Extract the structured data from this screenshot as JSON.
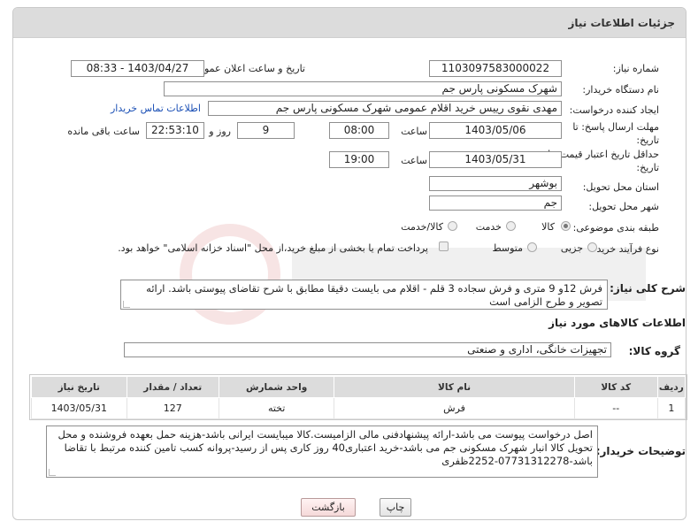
{
  "header": {
    "title": "جزئیات اطلاعات نیاز"
  },
  "fields": {
    "need_number_label": "شماره نیاز:",
    "need_number": "1103097583000022",
    "announce_label": "تاریخ و ساعت اعلان عمومی:",
    "announce_value": "1403/04/27 - 08:33",
    "buyer_org_label": "نام دستگاه خریدار:",
    "buyer_org": "شهرک مسکونی پارس جم",
    "requester_label": "ایجاد کننده درخواست:",
    "requester": "مهدی نقوی رییس خرید اقلام عمومی شهرک مسکونی پارس جم",
    "contact_link": "اطلاعات تماس خریدار",
    "deadline_label_1": "مهلت ارسال پاسخ: تا",
    "deadline_label_2": "تاریخ:",
    "deadline_date": "1403/05/06",
    "time_label": "ساعت",
    "deadline_time": "08:00",
    "days_value": "9",
    "days_label": "روز و",
    "remaining_value": "22:53:10",
    "remaining_label": "ساعت باقی مانده",
    "validity_label_1": "حداقل تاریخ اعتبار قیمت: تا",
    "validity_label_2": "تاریخ:",
    "validity_date": "1403/05/31",
    "validity_time_label": "ساعت",
    "validity_time": "19:00",
    "province_label": "استان محل تحویل:",
    "province": "بوشهر",
    "city_label": "شهر محل تحویل:",
    "city": "جم",
    "category_label": "طبقه بندی موضوعی:",
    "category_options": [
      "کالا",
      "خدمت",
      "کالا/خدمت"
    ],
    "process_label": "نوع فرآیند خرید :",
    "process_options": [
      "جزیی",
      "متوسط"
    ],
    "payment_note": "پرداخت تمام یا بخشی از مبلغ خرید،از محل \"اسناد خزانه اسلامی\" خواهد بود.",
    "description_label": "شرح کلی نیاز:",
    "description": "فرش 12و 9  متری و فرش سجاده 3 قلم - اقلام می بایست دقیقا مطابق با شرح تقاضای پیوستی باشد. ارائه تصویر و طرح الزامی است"
  },
  "goods_section": {
    "title": "اطلاعات کالاهای مورد نیاز",
    "group_label": "گروه کالا:",
    "group_value": "تجهیزات خانگی، اداری و صنعتی"
  },
  "table": {
    "headers": [
      "ردیف",
      "کد کالا",
      "نام کالا",
      "واحد شمارش",
      "تعداد / مقدار",
      "تاریخ نیاز"
    ],
    "rows": [
      [
        "1",
        "--",
        "فرش",
        "تخته",
        "127",
        "1403/05/31"
      ]
    ]
  },
  "buyer_notes": {
    "label": "توضیحات خریدار:",
    "text": "اصل درخواست پیوست می باشد-ارائه پیشنهادفنی مالی الزامیست.کالا میبایست ایرانی باشد-هزینه حمل بعهده فروشنده و محل تحویل کالا انبار شهرک مسکونی جم می باشد-خرید اعتباری40 روز کاری پس از رسید-پروانه کسب تامین کننده مرتبط با تقاضا باشد-07731312278-2252ظفری"
  },
  "buttons": {
    "print": "چاپ",
    "back": "بازگشت"
  },
  "colors": {
    "header_bg": "#dcdcdc",
    "link": "#1a4fb5",
    "back_button_tint": "#f5d9d9"
  }
}
